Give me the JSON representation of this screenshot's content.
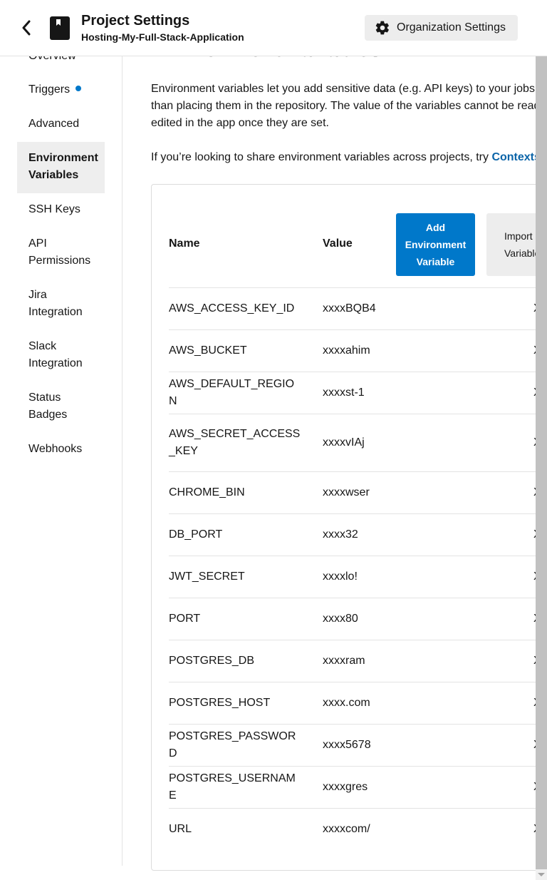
{
  "header": {
    "back_icon": "chevron-left-icon",
    "project_icon": "bookmark-book-icon",
    "title": "Project Settings",
    "subtitle": "Hosting-My-Full-Stack-Application",
    "org_settings_label": "Organization Settings",
    "org_settings_icon": "gear-icon"
  },
  "sidebar": {
    "items": [
      {
        "label": "Overview"
      },
      {
        "label": "Triggers",
        "indicator": "blue-dot"
      },
      {
        "label": "Advanced"
      },
      {
        "label": "Environment Variables",
        "active": true
      },
      {
        "label": "SSH Keys"
      },
      {
        "label": "API Permissions"
      },
      {
        "label": "Jira Integration"
      },
      {
        "label": "Slack Integration"
      },
      {
        "label": "Status Badges"
      },
      {
        "label": "Webhooks"
      }
    ]
  },
  "main": {
    "section_title": "Environment Variables",
    "description_line1": "Environment variables let you add sensitive data (e.g. API keys) to your jobs",
    "description_line2": "than placing them in the repository. The value of the variables cannot be read",
    "description_line3": "edited in the app once they are set.",
    "share_text": "If you’re looking to share environment variables across projects, try ",
    "share_link": "Contexts",
    "table": {
      "col_name": "Name",
      "col_value": "Value",
      "add_button_line1": "Add",
      "add_button_line2": "Environment",
      "add_button_line3": "Variable",
      "import_button_line1": "Import",
      "import_button_line2": "Variable",
      "delete_glyph": "X",
      "rows": [
        {
          "name": "AWS_ACCESS_KEY_ID",
          "value": "xxxxBQB4"
        },
        {
          "name": "AWS_BUCKET",
          "value": "xxxxahim"
        },
        {
          "name": "AWS_DEFAULT_REGION",
          "value": "xxxxst-1"
        },
        {
          "name": "AWS_SECRET_ACCESS_KEY",
          "value": "xxxxvIAj"
        },
        {
          "name": "CHROME_BIN",
          "value": "xxxxwser"
        },
        {
          "name": "DB_PORT",
          "value": "xxxx32"
        },
        {
          "name": "JWT_SECRET",
          "value": "xxxxlo!"
        },
        {
          "name": "PORT",
          "value": "xxxx80"
        },
        {
          "name": "POSTGRES_DB",
          "value": "xxxxram"
        },
        {
          "name": "POSTGRES_HOST",
          "value": "xxxx.com"
        },
        {
          "name": "POSTGRES_PASSWORD",
          "value": "xxxx5678"
        },
        {
          "name": "POSTGRES_USERNAME",
          "value": "xxxxgres"
        },
        {
          "name": "URL",
          "value": "xxxxcom/"
        }
      ]
    }
  },
  "colors": {
    "accent": "#0078ca",
    "link": "#0b64a8",
    "active_nav_bg": "#eeeeee",
    "secondary_button_bg": "#ededed"
  }
}
